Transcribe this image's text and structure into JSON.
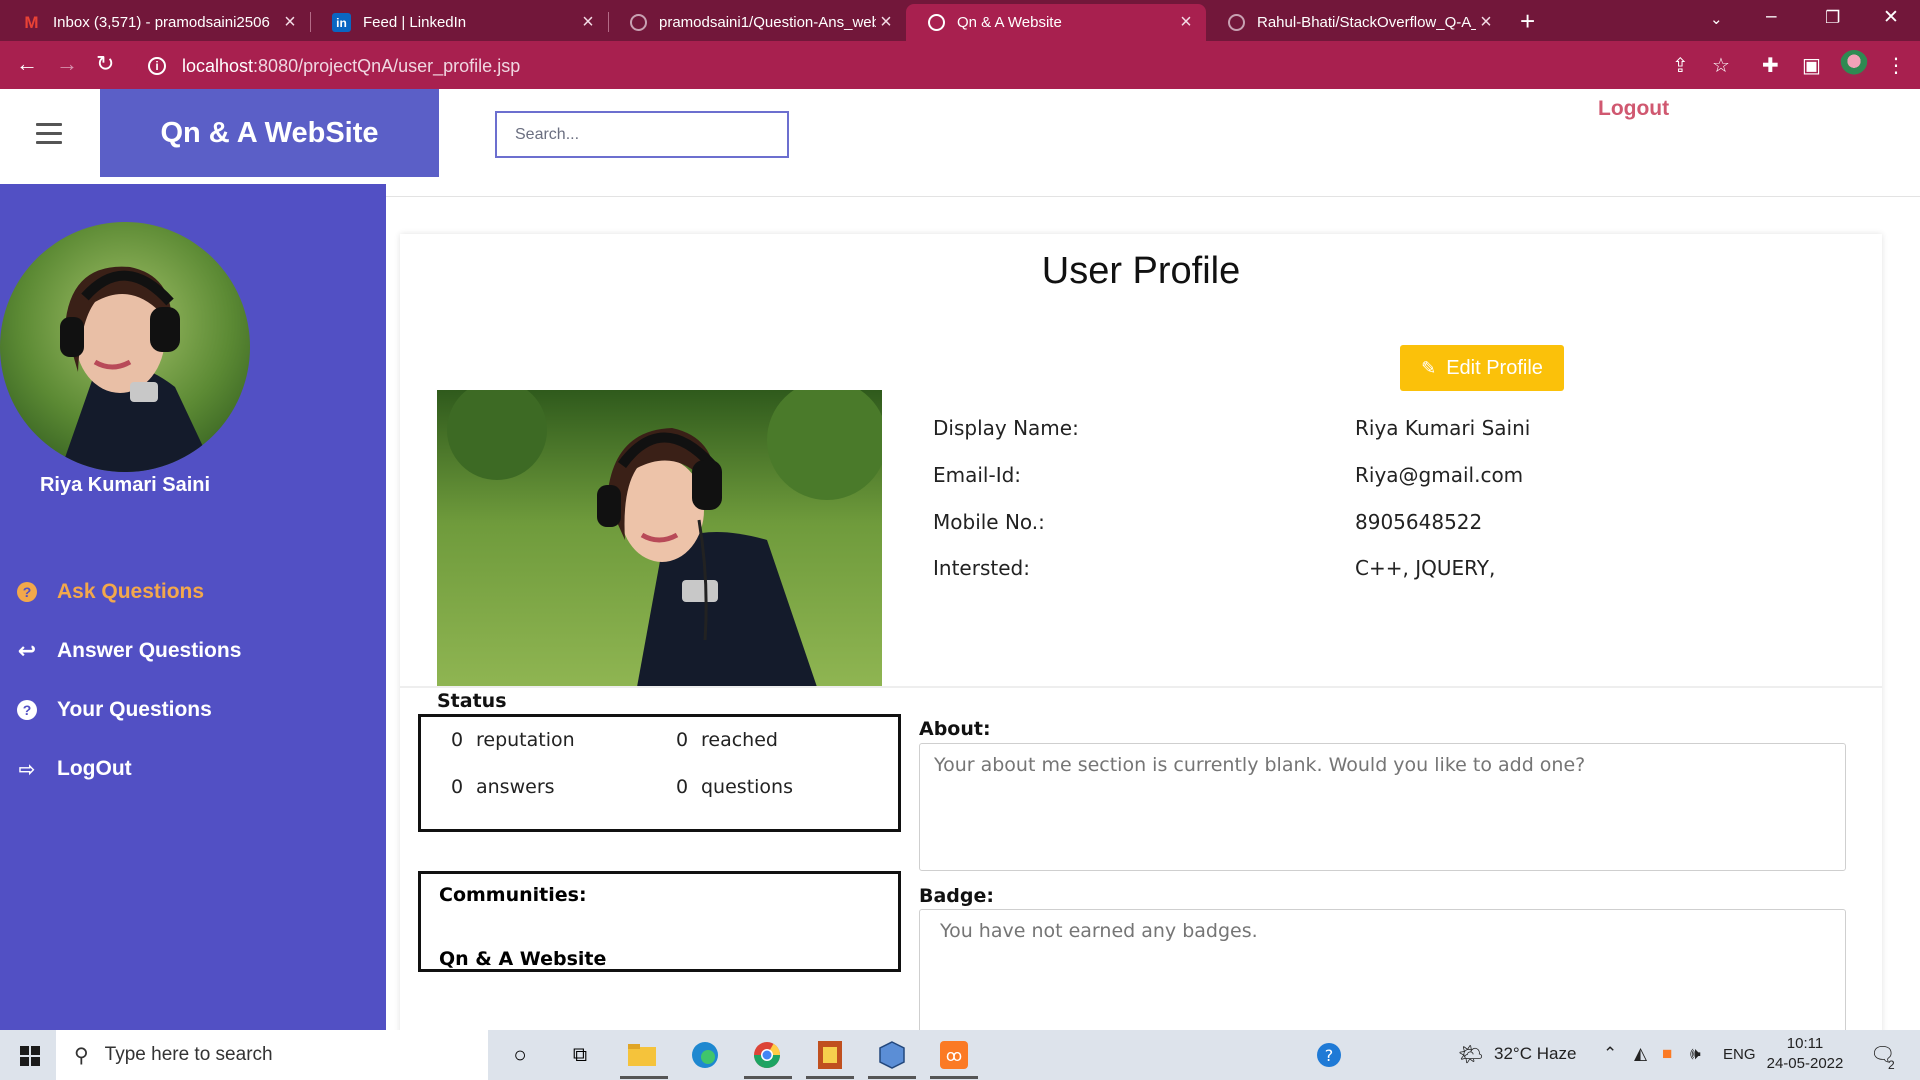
{
  "browser": {
    "tabs": [
      {
        "title": "Inbox (3,571) - pramodsaini2506",
        "icon": "gmail-icon"
      },
      {
        "title": "Feed | LinkedIn",
        "icon": "linkedin-icon"
      },
      {
        "title": "pramodsaini1/Question-Ans_web",
        "icon": "github-icon"
      },
      {
        "title": "Qn & A Website",
        "icon": "globe-icon",
        "active": true
      },
      {
        "title": "Rahul-Bhati/StackOverflow_Q-A_",
        "icon": "github-icon"
      }
    ],
    "url_host": "localhost",
    "url_rest": ":8080/projectQnA/user_profile.jsp"
  },
  "header": {
    "brand": "Qn & A WebSite",
    "search_placeholder": "Search...",
    "logout": "Logout"
  },
  "sidebar": {
    "user_name": "Riya Kumari Saini",
    "items": [
      {
        "label": "Ask Questions",
        "icon": "question-circle-icon",
        "active": true
      },
      {
        "label": "Answer Questions",
        "icon": "reply-icon"
      },
      {
        "label": "Your Questions",
        "icon": "question-circle-icon"
      },
      {
        "label": "LogOut",
        "icon": "sign-out-icon"
      }
    ]
  },
  "profile": {
    "title": "User Profile",
    "edit_button": "Edit Profile",
    "fields": [
      {
        "label": "Display Name:",
        "value": "Riya Kumari Saini"
      },
      {
        "label": "Email-Id:",
        "value": "Riya@gmail.com"
      },
      {
        "label": "Mobile No.:",
        "value": "8905648522"
      },
      {
        "label": "Intersted:",
        "value": "C++, JQUERY,"
      }
    ],
    "status": {
      "title": "Status",
      "reputation": {
        "value": "0",
        "label": "reputation"
      },
      "reached": {
        "value": "0",
        "label": "reached"
      },
      "answers": {
        "value": "0",
        "label": "answers"
      },
      "questions": {
        "value": "0",
        "label": "questions"
      }
    },
    "communities": {
      "title": "Communities:",
      "item": "Qn & A Website"
    },
    "about": {
      "label": "About:",
      "placeholder": "Your about me section is currently blank. Would you like to add one?"
    },
    "badge": {
      "label": "Badge:",
      "placeholder": "You have not earned any badges."
    }
  },
  "taskbar": {
    "search_placeholder": "Type here to search",
    "weather": "32°C  Haze",
    "lang": "ENG",
    "time": "10:11",
    "date": "24-05-2022",
    "notifications": "2"
  },
  "colors": {
    "sidebar": "#5250c4",
    "brand": "#5b5fc7",
    "accent_orange": "#f3a84b",
    "edit_button": "#fbc10a",
    "tab_bar": "#72173a",
    "address_bar": "#a8204f"
  }
}
